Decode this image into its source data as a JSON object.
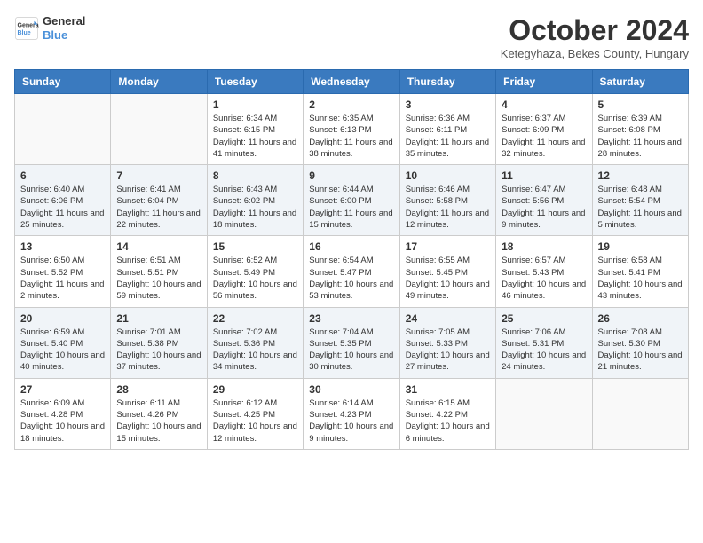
{
  "header": {
    "logo_line1": "General",
    "logo_line2": "Blue",
    "month_title": "October 2024",
    "location": "Ketegyhaza, Bekes County, Hungary"
  },
  "days_of_week": [
    "Sunday",
    "Monday",
    "Tuesday",
    "Wednesday",
    "Thursday",
    "Friday",
    "Saturday"
  ],
  "weeks": [
    [
      {
        "day": "",
        "info": ""
      },
      {
        "day": "",
        "info": ""
      },
      {
        "day": "1",
        "info": "Sunrise: 6:34 AM\nSunset: 6:15 PM\nDaylight: 11 hours and 41 minutes."
      },
      {
        "day": "2",
        "info": "Sunrise: 6:35 AM\nSunset: 6:13 PM\nDaylight: 11 hours and 38 minutes."
      },
      {
        "day": "3",
        "info": "Sunrise: 6:36 AM\nSunset: 6:11 PM\nDaylight: 11 hours and 35 minutes."
      },
      {
        "day": "4",
        "info": "Sunrise: 6:37 AM\nSunset: 6:09 PM\nDaylight: 11 hours and 32 minutes."
      },
      {
        "day": "5",
        "info": "Sunrise: 6:39 AM\nSunset: 6:08 PM\nDaylight: 11 hours and 28 minutes."
      }
    ],
    [
      {
        "day": "6",
        "info": "Sunrise: 6:40 AM\nSunset: 6:06 PM\nDaylight: 11 hours and 25 minutes."
      },
      {
        "day": "7",
        "info": "Sunrise: 6:41 AM\nSunset: 6:04 PM\nDaylight: 11 hours and 22 minutes."
      },
      {
        "day": "8",
        "info": "Sunrise: 6:43 AM\nSunset: 6:02 PM\nDaylight: 11 hours and 18 minutes."
      },
      {
        "day": "9",
        "info": "Sunrise: 6:44 AM\nSunset: 6:00 PM\nDaylight: 11 hours and 15 minutes."
      },
      {
        "day": "10",
        "info": "Sunrise: 6:46 AM\nSunset: 5:58 PM\nDaylight: 11 hours and 12 minutes."
      },
      {
        "day": "11",
        "info": "Sunrise: 6:47 AM\nSunset: 5:56 PM\nDaylight: 11 hours and 9 minutes."
      },
      {
        "day": "12",
        "info": "Sunrise: 6:48 AM\nSunset: 5:54 PM\nDaylight: 11 hours and 5 minutes."
      }
    ],
    [
      {
        "day": "13",
        "info": "Sunrise: 6:50 AM\nSunset: 5:52 PM\nDaylight: 11 hours and 2 minutes."
      },
      {
        "day": "14",
        "info": "Sunrise: 6:51 AM\nSunset: 5:51 PM\nDaylight: 10 hours and 59 minutes."
      },
      {
        "day": "15",
        "info": "Sunrise: 6:52 AM\nSunset: 5:49 PM\nDaylight: 10 hours and 56 minutes."
      },
      {
        "day": "16",
        "info": "Sunrise: 6:54 AM\nSunset: 5:47 PM\nDaylight: 10 hours and 53 minutes."
      },
      {
        "day": "17",
        "info": "Sunrise: 6:55 AM\nSunset: 5:45 PM\nDaylight: 10 hours and 49 minutes."
      },
      {
        "day": "18",
        "info": "Sunrise: 6:57 AM\nSunset: 5:43 PM\nDaylight: 10 hours and 46 minutes."
      },
      {
        "day": "19",
        "info": "Sunrise: 6:58 AM\nSunset: 5:41 PM\nDaylight: 10 hours and 43 minutes."
      }
    ],
    [
      {
        "day": "20",
        "info": "Sunrise: 6:59 AM\nSunset: 5:40 PM\nDaylight: 10 hours and 40 minutes."
      },
      {
        "day": "21",
        "info": "Sunrise: 7:01 AM\nSunset: 5:38 PM\nDaylight: 10 hours and 37 minutes."
      },
      {
        "day": "22",
        "info": "Sunrise: 7:02 AM\nSunset: 5:36 PM\nDaylight: 10 hours and 34 minutes."
      },
      {
        "day": "23",
        "info": "Sunrise: 7:04 AM\nSunset: 5:35 PM\nDaylight: 10 hours and 30 minutes."
      },
      {
        "day": "24",
        "info": "Sunrise: 7:05 AM\nSunset: 5:33 PM\nDaylight: 10 hours and 27 minutes."
      },
      {
        "day": "25",
        "info": "Sunrise: 7:06 AM\nSunset: 5:31 PM\nDaylight: 10 hours and 24 minutes."
      },
      {
        "day": "26",
        "info": "Sunrise: 7:08 AM\nSunset: 5:30 PM\nDaylight: 10 hours and 21 minutes."
      }
    ],
    [
      {
        "day": "27",
        "info": "Sunrise: 6:09 AM\nSunset: 4:28 PM\nDaylight: 10 hours and 18 minutes."
      },
      {
        "day": "28",
        "info": "Sunrise: 6:11 AM\nSunset: 4:26 PM\nDaylight: 10 hours and 15 minutes."
      },
      {
        "day": "29",
        "info": "Sunrise: 6:12 AM\nSunset: 4:25 PM\nDaylight: 10 hours and 12 minutes."
      },
      {
        "day": "30",
        "info": "Sunrise: 6:14 AM\nSunset: 4:23 PM\nDaylight: 10 hours and 9 minutes."
      },
      {
        "day": "31",
        "info": "Sunrise: 6:15 AM\nSunset: 4:22 PM\nDaylight: 10 hours and 6 minutes."
      },
      {
        "day": "",
        "info": ""
      },
      {
        "day": "",
        "info": ""
      }
    ]
  ]
}
